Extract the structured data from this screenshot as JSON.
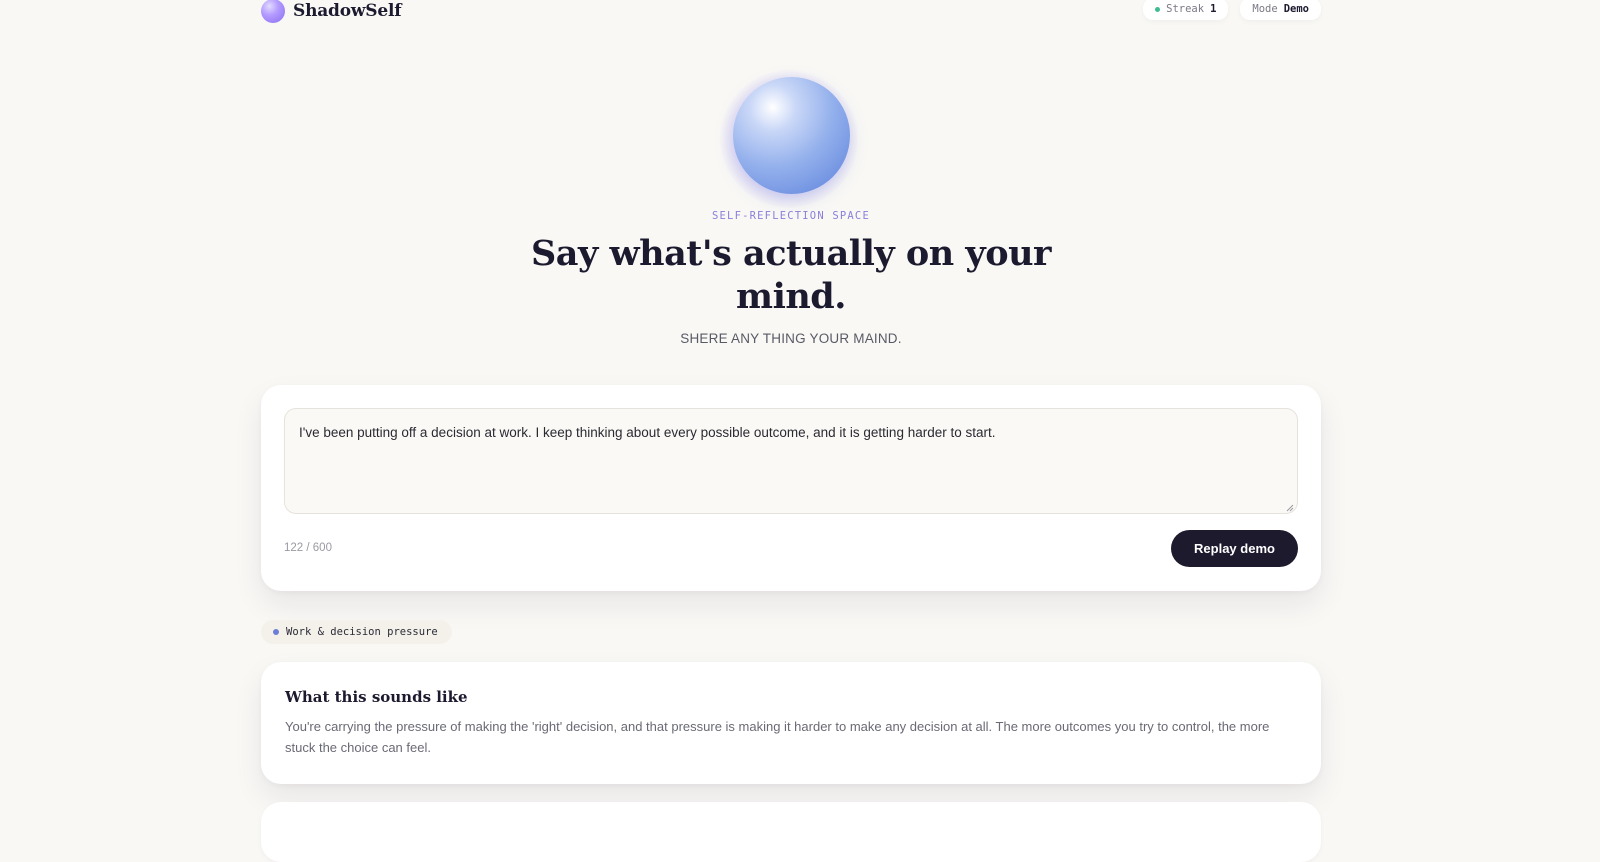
{
  "header": {
    "brand_name": "ShadowSelf",
    "streak_label": "Streak",
    "streak_value": "1",
    "mode_label": "Mode",
    "mode_value": "Demo"
  },
  "hero": {
    "eyebrow": "SELF-REFLECTION SPACE",
    "headline_line1": "Say what's actually on your",
    "headline_line2": "mind.",
    "subline": "SHERE ANY THING YOUR MAIND."
  },
  "composer": {
    "text_value": "I've been putting off a decision at work. I keep thinking about every possible outcome, and it is getting harder to start.",
    "counter": "122 / 600",
    "replay_label": "Replay demo"
  },
  "topic_tag": {
    "label": "Work & decision pressure"
  },
  "insight": {
    "title": "What this sounds like",
    "body": "You're carrying the pressure of making the 'right' decision, and that pressure is making it harder to make any decision at all. The more outcomes you try to control, the more stuck the choice can feel."
  },
  "colors": {
    "accent_dark": "#1d1a2e",
    "streak_dot": "#3ebd93",
    "tag_dot": "#6c7fd4",
    "eyebrow": "#8a7fd8"
  }
}
